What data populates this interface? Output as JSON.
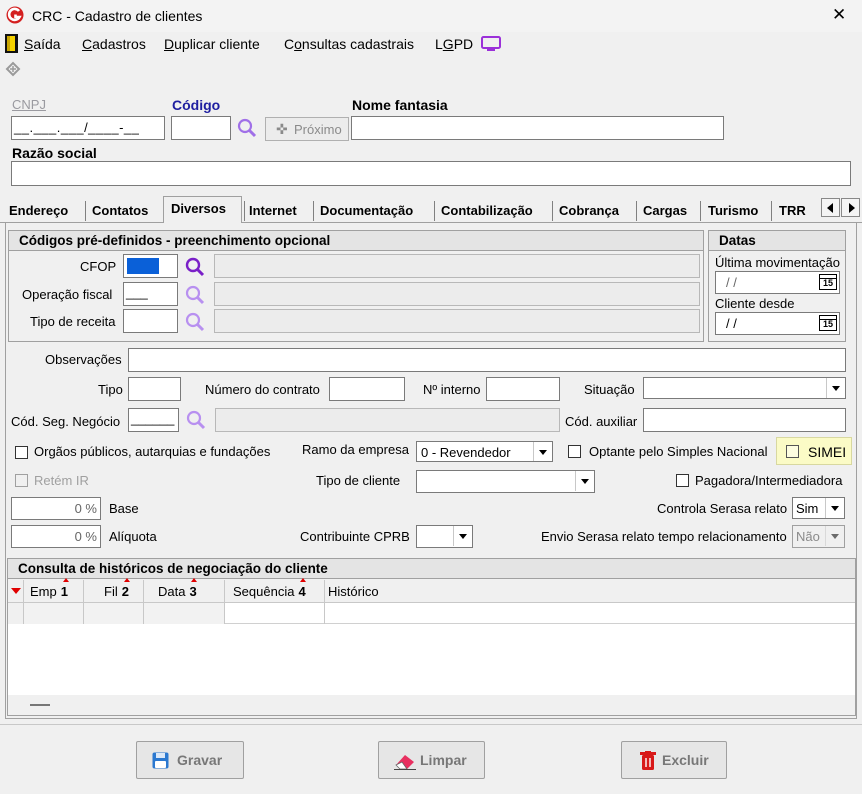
{
  "window": {
    "title": "CRC - Cadastro de clientes",
    "close_glyph": "✕"
  },
  "menu": {
    "items": [
      "Saída",
      "Cadastros",
      "Duplicar cliente",
      "Consultas cadastrais",
      "LGPD"
    ]
  },
  "header": {
    "cnpj_label": "CNPJ",
    "cnpj_mask": "__.___.___/____-__",
    "codigo_label": "Código",
    "proximo_label": "Próximo",
    "nome_fantasia_label": "Nome fantasia",
    "razao_social_label": "Razão social"
  },
  "tabs": [
    "Endereço",
    "Contatos",
    "Diversos",
    "Internet",
    "Documentação",
    "Contabilização",
    "Cobrança",
    "Cargas",
    "Turismo",
    "TRR"
  ],
  "active_tab": "Diversos",
  "codigos": {
    "title": "Códigos pré-definidos - preenchimento opcional",
    "cfop_label": "CFOP",
    "operacao_label": "Operação fiscal",
    "operacao_value": "___",
    "tipo_receita_label": "Tipo de receita"
  },
  "datas": {
    "title": "Datas",
    "ultima_label": "Última movimentação",
    "ultima_value": " / /",
    "cliente_desde_label": "Cliente desde",
    "cliente_desde_value": " / /",
    "cal_day": "15"
  },
  "form": {
    "observacoes_label": "Observações",
    "tipo_label": "Tipo",
    "numero_contrato_label": "Número do contrato",
    "n_interno_label": "Nº interno",
    "situacao_label": "Situação",
    "cod_seg_label": "Cód. Seg. Negócio",
    "cod_seg_value": "______",
    "cod_aux_label": "Cód. auxiliar",
    "orgaos_label": "Orgãos públicos, autarquias e fundações",
    "ramo_label": "Ramo da empresa",
    "ramo_value": "0 - Revendedor",
    "optante_label": "Optante pelo Simples Nacional",
    "simei_label": "SIMEI",
    "retem_label": "Retém IR",
    "tipo_cliente_label": "Tipo de cliente",
    "pagadora_label": "Pagadora/Intermediadora",
    "base_value": "0 %",
    "base_label": "Base",
    "aliquota_value": "0 %",
    "aliquota_label": "Alíquota",
    "serasa_label": "Controla Serasa relato",
    "serasa_value": "Sim",
    "cprb_label": "Contribuinte CPRB",
    "envio_label": "Envio Serasa relato tempo relacionamento",
    "envio_value": "Não"
  },
  "historico": {
    "title": "Consulta de históricos de negociação do cliente",
    "columns": [
      {
        "label": "Emp",
        "sort": "1"
      },
      {
        "label": "Fil",
        "sort": "2"
      },
      {
        "label": "Data",
        "sort": "3"
      },
      {
        "label": "Sequência",
        "sort": "4"
      },
      {
        "label": "Histórico",
        "sort": ""
      }
    ]
  },
  "buttons": {
    "gravar": "Gravar",
    "limpar": "Limpar",
    "excluir": "Excluir"
  },
  "colors": {
    "accent_purple": "#9b30d9",
    "simei_bg": "#fbfbc6",
    "cfop_fill": "#0a60d8",
    "logo_red": "#d42020"
  }
}
